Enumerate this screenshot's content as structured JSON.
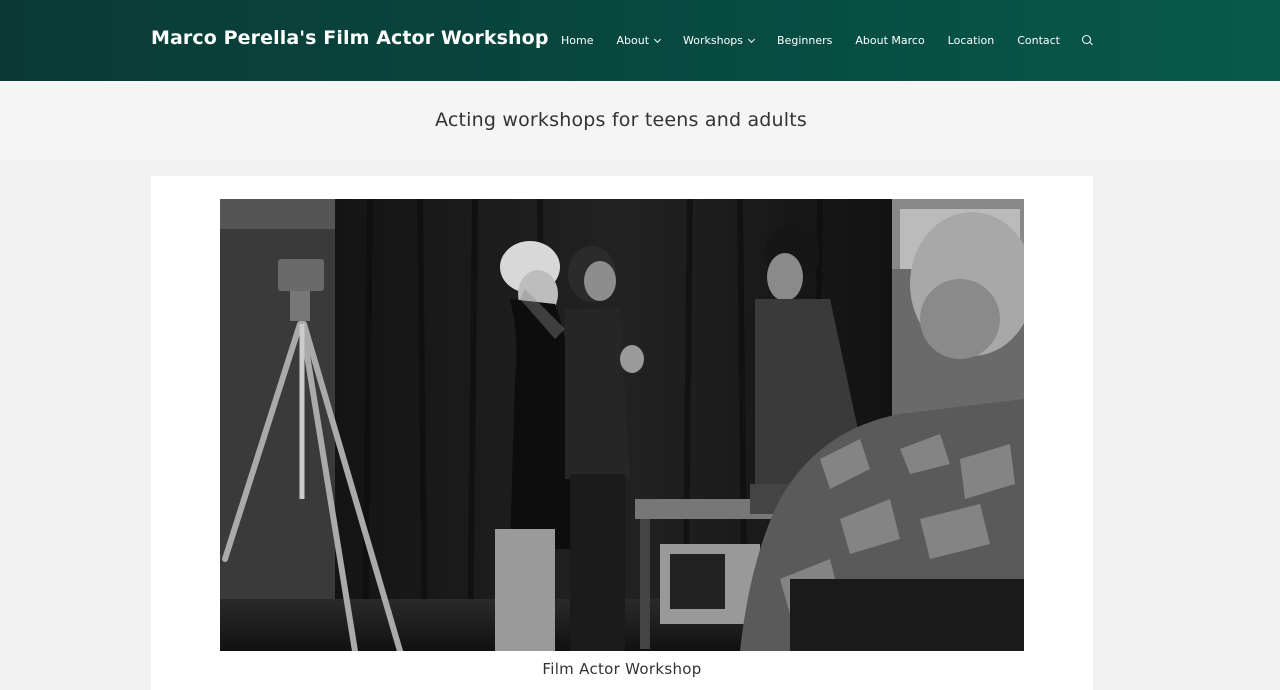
{
  "header": {
    "site_title": "Marco Perella's Film Actor Workshop",
    "nav": [
      {
        "label": "Home",
        "has_dropdown": false
      },
      {
        "label": "About",
        "has_dropdown": true
      },
      {
        "label": "Workshops",
        "has_dropdown": true
      },
      {
        "label": "Beginners",
        "has_dropdown": false
      },
      {
        "label": "About Marco",
        "has_dropdown": false
      },
      {
        "label": "Location",
        "has_dropdown": false
      },
      {
        "label": "Contact",
        "has_dropdown": false
      }
    ],
    "search_icon": "search-icon",
    "gradient_colors": [
      "#0b3a36",
      "#075a4a"
    ]
  },
  "page": {
    "title": "Acting workshops for teens and adults"
  },
  "content": {
    "caption": "Film Actor Workshop"
  }
}
